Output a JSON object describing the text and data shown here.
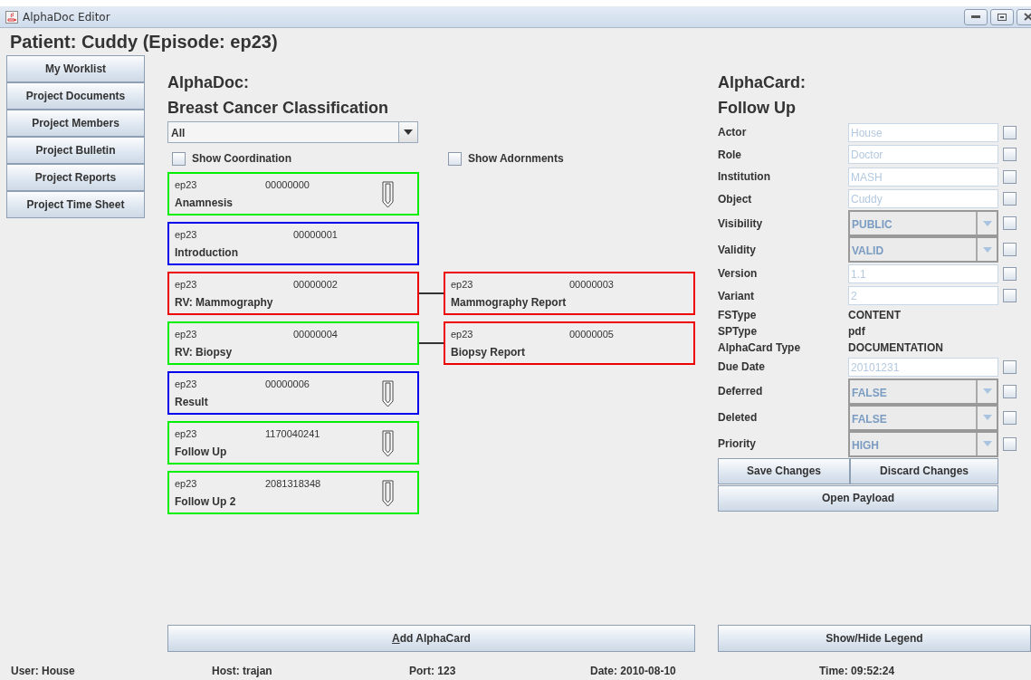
{
  "window": {
    "title": "AlphaDoc Editor"
  },
  "header": "Patient: Cuddy (Episode: ep23)",
  "sidebar": {
    "items": [
      "My Worklist",
      "Project Documents",
      "Project Members",
      "Project Bulletin",
      "Project Reports",
      "Project Time Sheet"
    ]
  },
  "document": {
    "heading": "AlphaDoc:",
    "title": "Breast Cancer Classification",
    "filter": "All",
    "options": [
      {
        "label": "Show Coordination",
        "checked": false
      },
      {
        "label": "Show Adornments",
        "checked": false
      }
    ],
    "cards": [
      {
        "episode": "ep23",
        "number": "00000000",
        "title": "Anamnesis",
        "color": "#00ee00",
        "attachment": true
      },
      {
        "episode": "ep23",
        "number": "00000001",
        "title": "Introduction",
        "color": "#0000ee",
        "attachment": false
      },
      {
        "episode": "ep23",
        "number": "00000002",
        "title": "RV: Mammography",
        "color": "#ee0000",
        "attachment": false,
        "linked": {
          "episode": "ep23",
          "number": "00000003",
          "title": "Mammography Report",
          "color": "#ee0000",
          "attachment": false
        }
      },
      {
        "episode": "ep23",
        "number": "00000004",
        "title": "RV: Biopsy",
        "color": "#00ee00",
        "attachment": false,
        "linked": {
          "episode": "ep23",
          "number": "00000005",
          "title": "Biopsy Report",
          "color": "#ee0000",
          "attachment": false
        }
      },
      {
        "episode": "ep23",
        "number": "00000006",
        "title": "Result",
        "color": "#0000ee",
        "attachment": true
      },
      {
        "episode": "ep23",
        "number": "1170040241",
        "title": "Follow Up",
        "color": "#00ee00",
        "attachment": true
      },
      {
        "episode": "ep23",
        "number": "2081318348",
        "title": "Follow Up 2",
        "color": "#00ee00",
        "attachment": true
      }
    ],
    "add_button": {
      "label": "Add AlphaCard"
    }
  },
  "card": {
    "heading": "AlphaCard:",
    "title": "Follow Up",
    "fields": [
      {
        "kind": "text",
        "label": "Actor",
        "value": "House",
        "checked": false
      },
      {
        "kind": "text",
        "label": "Role",
        "value": "Doctor",
        "checked": false
      },
      {
        "kind": "text",
        "label": "Institution",
        "value": "MASH",
        "checked": false
      },
      {
        "kind": "text",
        "label": "Object",
        "value": "Cuddy",
        "checked": false
      },
      {
        "kind": "combo",
        "label": "Visibility",
        "value": "PUBLIC",
        "checked": false
      },
      {
        "kind": "combo",
        "label": "Validity",
        "value": "VALID",
        "checked": false
      },
      {
        "kind": "text",
        "label": "Version",
        "value": "1.1",
        "checked": false
      },
      {
        "kind": "text",
        "label": "Variant",
        "value": "2",
        "checked": false
      },
      {
        "kind": "static",
        "label": "FSType",
        "value": "CONTENT"
      },
      {
        "kind": "static",
        "label": "SPType",
        "value": "pdf"
      },
      {
        "kind": "static",
        "label": "AlphaCard Type",
        "value": "DOCUMENTATION"
      },
      {
        "kind": "text",
        "label": "Due Date",
        "value": "20101231",
        "checked": false
      },
      {
        "kind": "combo",
        "label": "Deferred",
        "value": "FALSE",
        "checked": false
      },
      {
        "kind": "combo",
        "label": "Deleted",
        "value": "FALSE",
        "checked": false
      },
      {
        "kind": "combo",
        "label": "Priority",
        "value": "HIGH",
        "checked": false
      }
    ],
    "buttons": [
      "Save Changes",
      "Discard Changes"
    ],
    "payload_button": "Open Payload",
    "legend_button": "Show/Hide Legend"
  },
  "status_bar": [
    "User: House",
    "Host: trajan",
    "Port: 123",
    "Date: 2010-08-10",
    "Time: 09:52:24"
  ]
}
